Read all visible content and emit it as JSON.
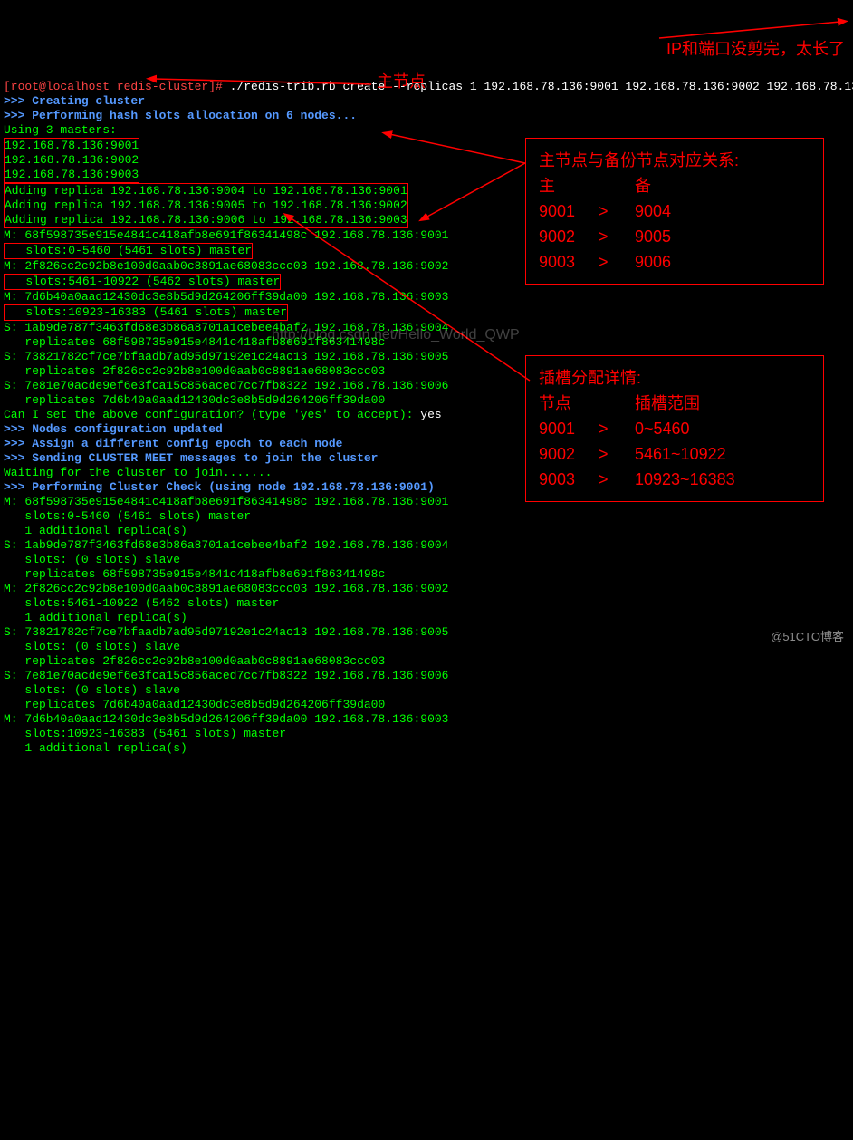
{
  "prompt": {
    "user": "[root@localhost redis-cluster]#",
    "cmd": " ./redis-trib.rb create --replicas 1 192.168.78.136:9001 192.168.78.136:9002 192.168.78.136:9003 192"
  },
  "lines": {
    "l1": ">>> Creating cluster",
    "l2": ">>> Performing hash slots allocation on 6 nodes...",
    "l3": "Using 3 masters:",
    "l4": "192.168.78.136:9001",
    "l5": "192.168.78.136:9002",
    "l6": "192.168.78.136:9003",
    "l7": "Adding replica 192.168.78.136:9004 to 192.168.78.136:9001",
    "l8": "Adding replica 192.168.78.136:9005 to 192.168.78.136:9002",
    "l9": "Adding replica 192.168.78.136:9006 to 192.168.78.136:9003",
    "l10": "M: 68f598735e915e4841c418afb8e691f86341498c 192.168.78.136:9001",
    "l11": "   slots:0-5460 (5461 slots) master",
    "l12": "M: 2f826cc2c92b8e100d0aab0c8891ae68083ccc03 192.168.78.136:9002",
    "l13": "   slots:5461-10922 (5462 slots) master",
    "l14": "M: 7d6b40a0aad12430dc3e8b5d9d264206ff39da00 192.168.78.136:9003",
    "l15": "   slots:10923-16383 (5461 slots) master",
    "l16": "S: 1ab9de787f3463fd68e3b86a8701a1cebee4baf2 192.168.78.136:9004",
    "l17": "   replicates 68f598735e915e4841c418afb8e691f86341498c",
    "l18": "S: 73821782cf7ce7bfaadb7ad95d97192e1c24ac13 192.168.78.136:9005",
    "l19": "   replicates 2f826cc2c92b8e100d0aab0c8891ae68083ccc03",
    "l20": "S: 7e81e70acde9ef6e3fca15c856aced7cc7fb8322 192.168.78.136:9006",
    "l21": "   replicates 7d6b40a0aad12430dc3e8b5d9d264206ff39da00",
    "l22a": "Can I set the above configuration? (type 'yes' to accept): ",
    "l22b": "yes",
    "l23": ">>> Nodes configuration updated",
    "l24": ">>> Assign a different config epoch to each node",
    "l25": ">>> Sending CLUSTER MEET messages to join the cluster",
    "l26": "Waiting for the cluster to join.......",
    "l27": ">>> Performing Cluster Check (using node 192.168.78.136:9001)",
    "l28": "M: 68f598735e915e4841c418afb8e691f86341498c 192.168.78.136:9001",
    "l29": "   slots:0-5460 (5461 slots) master",
    "l30": "   1 additional replica(s)",
    "l31": "S: 1ab9de787f3463fd68e3b86a8701a1cebee4baf2 192.168.78.136:9004",
    "l32": "   slots: (0 slots) slave",
    "l33": "   replicates 68f598735e915e4841c418afb8e691f86341498c",
    "l34": "M: 2f826cc2c92b8e100d0aab0c8891ae68083ccc03 192.168.78.136:9002",
    "l35": "   slots:5461-10922 (5462 slots) master",
    "l36": "   1 additional replica(s)",
    "l37": "S: 73821782cf7ce7bfaadb7ad95d97192e1c24ac13 192.168.78.136:9005",
    "l38": "   slots: (0 slots) slave",
    "l39": "   replicates 2f826cc2c92b8e100d0aab0c8891ae68083ccc03",
    "l40": "S: 7e81e70acde9ef6e3fca15c856aced7cc7fb8322 192.168.78.136:9006",
    "l41": "   slots: (0 slots) slave",
    "l42": "   replicates 7d6b40a0aad12430dc3e8b5d9d264206ff39da00",
    "l43": "M: 7d6b40a0aad12430dc3e8b5d9d264206ff39da00 192.168.78.136:9003",
    "l44": "   slots:10923-16383 (5461 slots) master",
    "l45": "   1 additional replica(s)"
  },
  "anno": {
    "masters_label": "主节点",
    "ip_trunc": "IP和端口没剪完，太长了",
    "relation_title": "主节点与备份节点对应关系:",
    "relation_h1": "主",
    "relation_h2": "备",
    "rel_rows": [
      {
        "master": "9001",
        "arrow": ">",
        "replica": "9004"
      },
      {
        "master": "9002",
        "arrow": ">",
        "replica": "9005"
      },
      {
        "master": "9003",
        "arrow": ">",
        "replica": "9006"
      }
    ],
    "slots_title": "插槽分配详情:",
    "slots_h1": "节点",
    "slots_h2": "插槽范围",
    "slot_rows": [
      {
        "node": "9001",
        "arrow": ">",
        "range": "0~5460"
      },
      {
        "node": "9002",
        "arrow": ">",
        "range": "5461~10922"
      },
      {
        "node": "9003",
        "arrow": ">",
        "range": "10923~16383"
      }
    ]
  },
  "watermark": {
    "center": "http://blog.csdn.net/Hello_World_QWP",
    "br": "@51CTO博客"
  }
}
